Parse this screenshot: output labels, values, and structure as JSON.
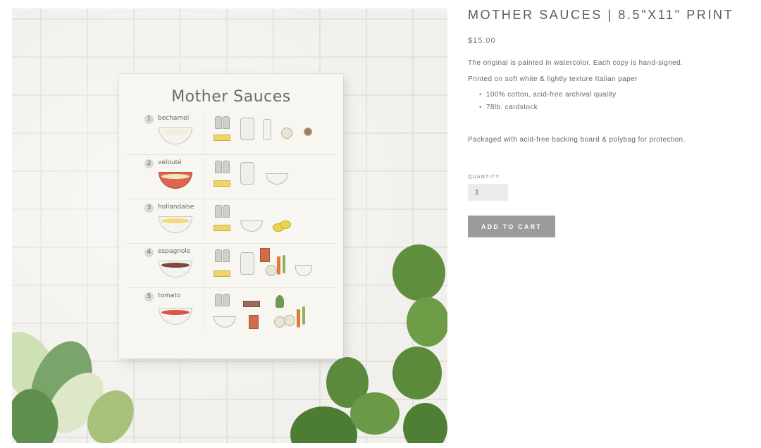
{
  "product": {
    "title": "MOTHER SAUCES | 8.5\"X11\" PRINT",
    "price": "$15.00",
    "description_line1": "The original is painted in watercolor.  Each copy is hand-signed.",
    "description_line2": "Printed on soft white & lightly texture Italian paper",
    "features": [
      "100% cotton, acid-free archival quality",
      "78lb. cardstock"
    ],
    "packaging_note": "Packaged with acid-free backing board & polybag for protection."
  },
  "purchase": {
    "quantity_label": "QUANTITY:",
    "quantity_value": "1",
    "add_to_cart_label": "ADD TO CART"
  },
  "poster": {
    "title": "Mother Sauces",
    "sauces": [
      {
        "number": "1",
        "name": "bechamel",
        "sauce_color": "#f2efd8"
      },
      {
        "number": "2",
        "name": "velouté",
        "sauce_color": "#efe6bf"
      },
      {
        "number": "3",
        "name": "hollandaise",
        "sauce_color": "#f0dc7a"
      },
      {
        "number": "4",
        "name": "espagnole",
        "sauce_color": "#7a4a3a"
      },
      {
        "number": "5",
        "name": "tomato",
        "sauce_color": "#d9544a"
      }
    ]
  },
  "colors": {
    "button_bg": "#9b9b9b",
    "input_bg": "#ebebeb",
    "title_text": "#5d5d5d"
  }
}
